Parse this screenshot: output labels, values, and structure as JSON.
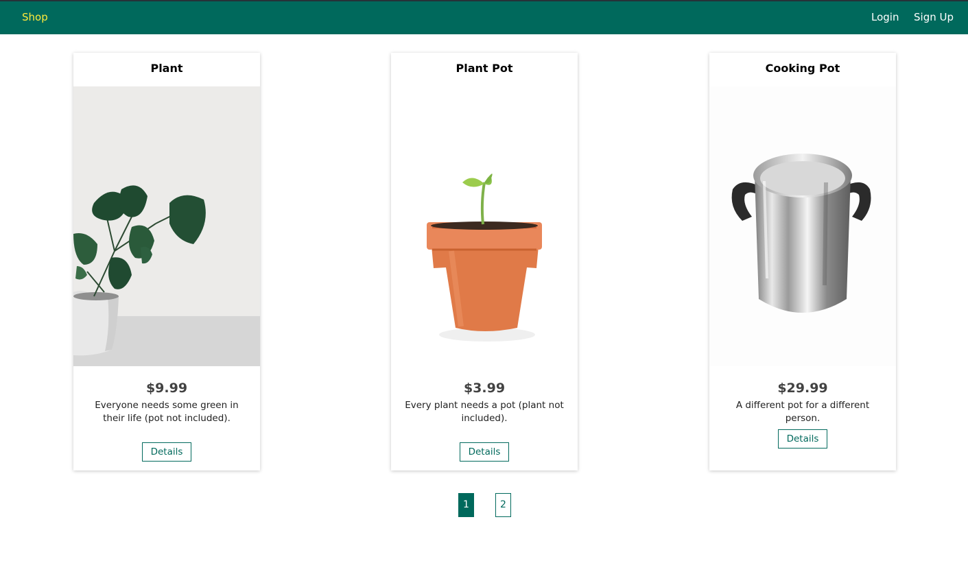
{
  "nav": {
    "brand": "Shop",
    "login": "Login",
    "signup": "Sign Up"
  },
  "products": [
    {
      "title": "Plant",
      "price": "$9.99",
      "description": "Everyone needs some green in their life (pot not included).",
      "button": "Details"
    },
    {
      "title": "Plant Pot",
      "price": "$3.99",
      "description": "Every plant needs a pot (plant not included).",
      "button": "Details"
    },
    {
      "title": "Cooking Pot",
      "price": "$29.99",
      "description": "A different pot for a different person.",
      "button": "Details"
    }
  ],
  "pagination": {
    "pages": [
      "1",
      "2"
    ],
    "active": "1"
  },
  "colors": {
    "primary": "#00695c",
    "brand_text": "#ffeb3b"
  }
}
